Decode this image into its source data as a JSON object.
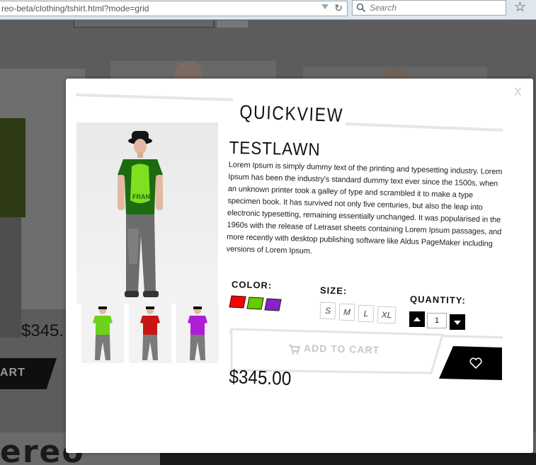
{
  "browser": {
    "url": "reo-beta/clothing/tshirt.html?mode=grid",
    "search_placeholder": "Search",
    "icons": [
      "reload-icon",
      "search-icon",
      "star-icon",
      "dropdown-icon"
    ]
  },
  "background": {
    "price": "$345.",
    "cart_label": "ART",
    "footer_logo": "ereo"
  },
  "quickview": {
    "title": "QUICKVIEW",
    "close_label": "X",
    "product_name": "TESTLAWN",
    "description": "Lorem Ipsum is simply dummy text of the printing and typesetting industry. Lorem Ipsum has been the industry's standard dummy text ever since the 1500s, when an unknown printer took a galley of type and scrambled it to make a type specimen book. It has survived not only five centuries, but also the leap into electronic typesetting, remaining essentially unchanged. It was popularised in the 1960s with the release of Letraset sheets containing Lorem Ipsum passages, and more recently with desktop publishing software like Aldus PageMaker including versions of Lorem Ipsum.",
    "color_label": "COLOR:",
    "colors": [
      "#ff0000",
      "#66cc00",
      "#8822cc"
    ],
    "size_label": "SIZE:",
    "sizes": [
      "S",
      "M",
      "L",
      "XL"
    ],
    "quantity_label": "QUANTITY:",
    "quantity_value": "1",
    "add_to_cart_label": "ADD TO CART",
    "price": "$345.00",
    "thumbnail_shirt_colors": [
      "#6fd21a",
      "#c81515",
      "#b01dd6"
    ]
  }
}
